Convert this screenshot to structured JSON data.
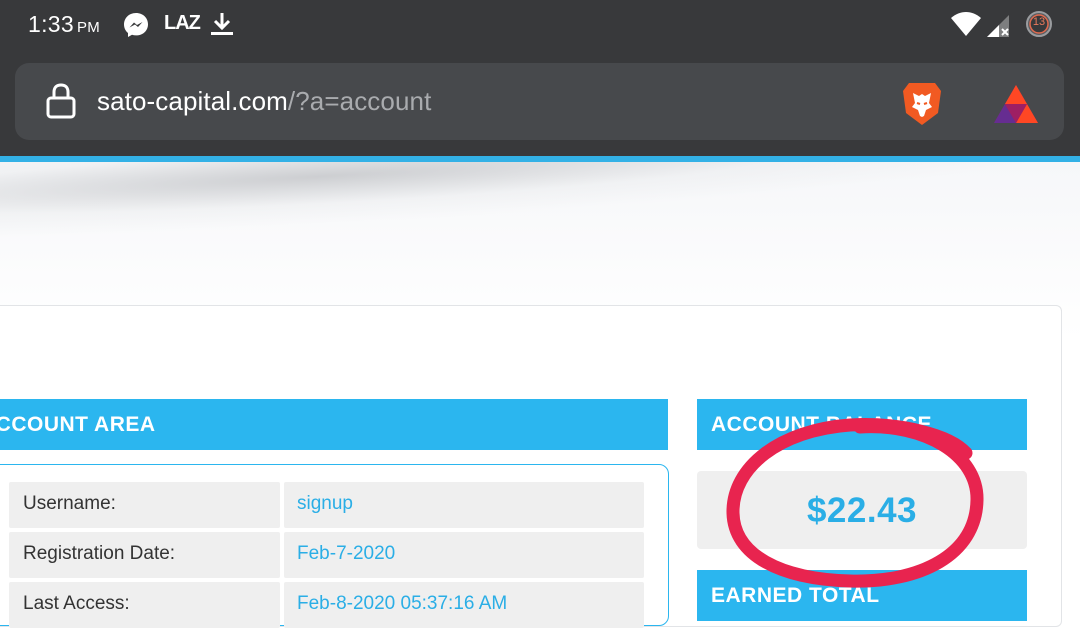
{
  "status_bar": {
    "time": "1:33",
    "time_suffix": "PM",
    "app_label": "LAZ",
    "notification_count": "13"
  },
  "browser": {
    "url_host": "sato-capital.com",
    "url_path": "/?a=account",
    "icons": [
      "lock-icon",
      "brave-lion-icon",
      "bat-rewards-icon"
    ]
  },
  "account_area": {
    "header": "ACCOUNT AREA",
    "rows": [
      {
        "label": "Username:",
        "value": "signup"
      },
      {
        "label": "Registration Date:",
        "value": "Feb-7-2020"
      },
      {
        "label": "Last Access:",
        "value": "Feb-8-2020 05:37:16 AM"
      }
    ]
  },
  "balance": {
    "header": "ACCOUNT BALANCE",
    "amount": "$22.43"
  },
  "earned": {
    "header": "EARNED TOTAL"
  },
  "colors": {
    "accent": "#2bb6ef",
    "chrome": "#38393b",
    "annotation": "#e8244f"
  }
}
